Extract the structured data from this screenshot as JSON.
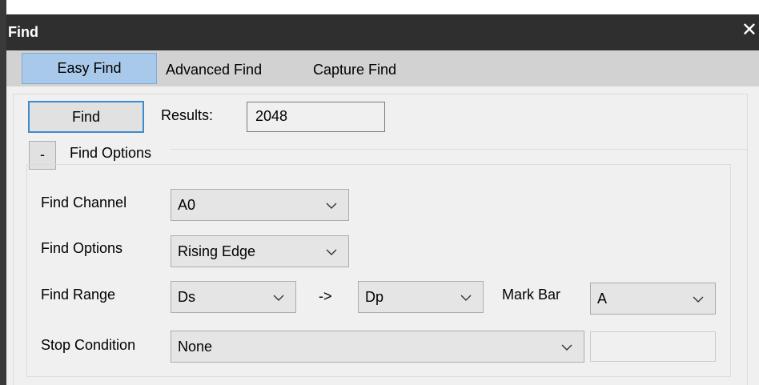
{
  "window": {
    "title": "Find",
    "close_glyph": "✕"
  },
  "tabs": [
    {
      "label": "Easy Find",
      "active": true
    },
    {
      "label": "Advanced Find",
      "active": false
    },
    {
      "label": "Capture Find",
      "active": false
    }
  ],
  "toolbar": {
    "find_label": "Find",
    "results_label": "Results:",
    "results_value": "2048"
  },
  "group": {
    "toggle_label": "-",
    "title": "Find Options"
  },
  "rows": {
    "channel": {
      "label": "Find Channel",
      "value": "A0"
    },
    "options": {
      "label": "Find Options",
      "value": "Rising Edge"
    },
    "range": {
      "label": "Find Range",
      "from": "Ds",
      "arrow": "->",
      "to": "Dp",
      "mark_label": "Mark Bar",
      "mark_value": "A"
    },
    "stop": {
      "label": "Stop Condition",
      "value": "None",
      "extra_value": ""
    }
  },
  "colors": {
    "titlebar": "#2f2f2f",
    "tab_active": "#a9c9ea",
    "focus_border": "#3c8ccf",
    "panel_bg": "#f0f0f0"
  }
}
